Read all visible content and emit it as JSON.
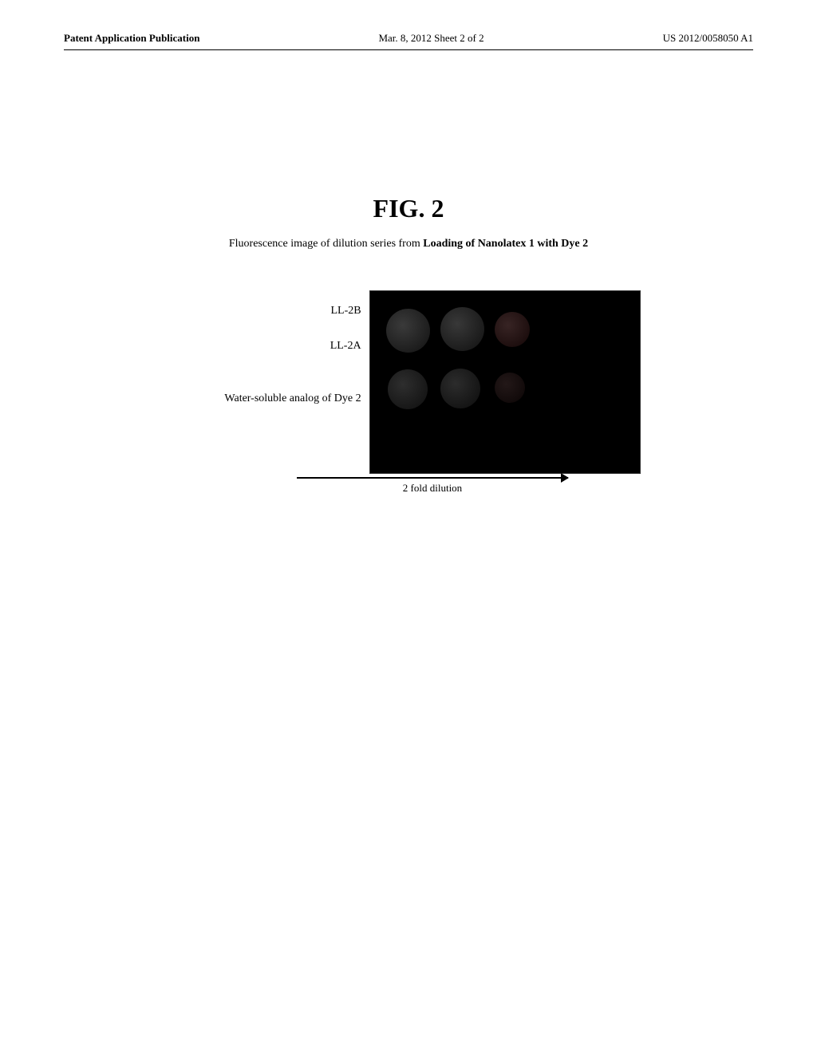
{
  "header": {
    "left": "Patent Application Publication",
    "center": "Mar. 8, 2012   Sheet 2 of 2",
    "right": "US 2012/0058050 A1"
  },
  "figure": {
    "title": "FIG. 2",
    "caption_prefix": "Fluorescence image of dilution series from ",
    "caption_bold": "Loading of Nanolatex 1 with Dye 2",
    "labels": {
      "ll2b": "LL-2B",
      "ll2a": "LL-2A",
      "water": "Water-soluble analog of Dye 2"
    },
    "arrow_label": "2 fold dilution"
  }
}
